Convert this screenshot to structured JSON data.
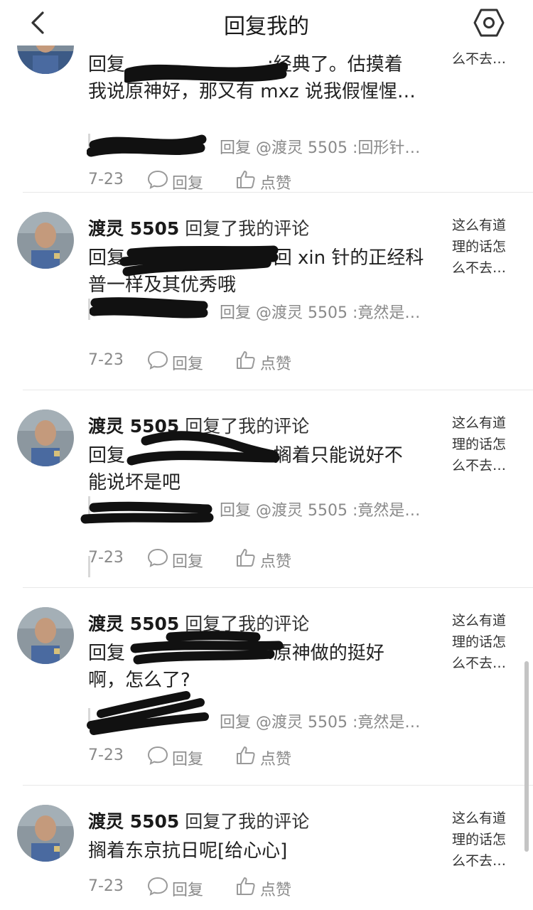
{
  "header": {
    "title": "回复我的",
    "back_icon": "chevron-left-icon",
    "settings_icon": "hexagon-settings-icon"
  },
  "items": [
    {
      "name": "",
      "action": "",
      "body": "回复▬▬▬▬▬▬▬▬:经典了。估摸着我说原神好，那又有 mxz 说我假惺惺…",
      "body_prefix": "回复",
      "body_text": ":经典了。估摸着",
      "body_line2": "我说原神好，那又有 mxz 说我假惺惺…",
      "quote": "回复 @渡灵 5505 :回形针…",
      "date": "7-23",
      "reply_label": "回复",
      "like_label": "点赞",
      "thumb": [
        "",
        "么不去…"
      ]
    },
    {
      "name": "渡灵 5505",
      "action": "回复了我的评论",
      "body_prefix": "回复",
      "body_text": ":回 xin 针的正经科",
      "body_line2": "普一样及其优秀哦",
      "quote": "回复 @渡灵 5505 :竟然是…",
      "date": "7-23",
      "reply_label": "回复",
      "like_label": "点赞",
      "thumb": [
        "这么有道",
        "理的话怎",
        "么不去…"
      ]
    },
    {
      "name": "渡灵 5505",
      "action": "回复了我的评论",
      "body_prefix": "回复",
      "body_text": ":搁着只能说好不",
      "body_line2": "能说坏是吧",
      "quote": "回复 @渡灵 5505 :竟然是…",
      "date": "7-23",
      "reply_label": "回复",
      "like_label": "点赞",
      "thumb": [
        "这么有道",
        "理的话怎",
        "么不去…"
      ]
    },
    {
      "name": "渡灵 5505",
      "action": "回复了我的评论",
      "body_prefix": "回复",
      "body_text": ":原神做的挺好",
      "body_line2": "啊，怎么了?",
      "quote": "回复 @渡灵 5505 :竟然是…",
      "date": "7-23",
      "reply_label": "回复",
      "like_label": "点赞",
      "thumb": [
        "这么有道",
        "理的话怎",
        "么不去…"
      ]
    },
    {
      "name": "渡灵 5505",
      "action": "回复了我的评论",
      "body_prefix": "",
      "body_text": "搁着东京抗日呢[给心心]",
      "body_line2": "",
      "quote": "",
      "date": "7-23",
      "reply_label": "回复",
      "like_label": "点赞",
      "thumb": [
        "这么有道",
        "理的话怎",
        "么不去…"
      ]
    }
  ]
}
